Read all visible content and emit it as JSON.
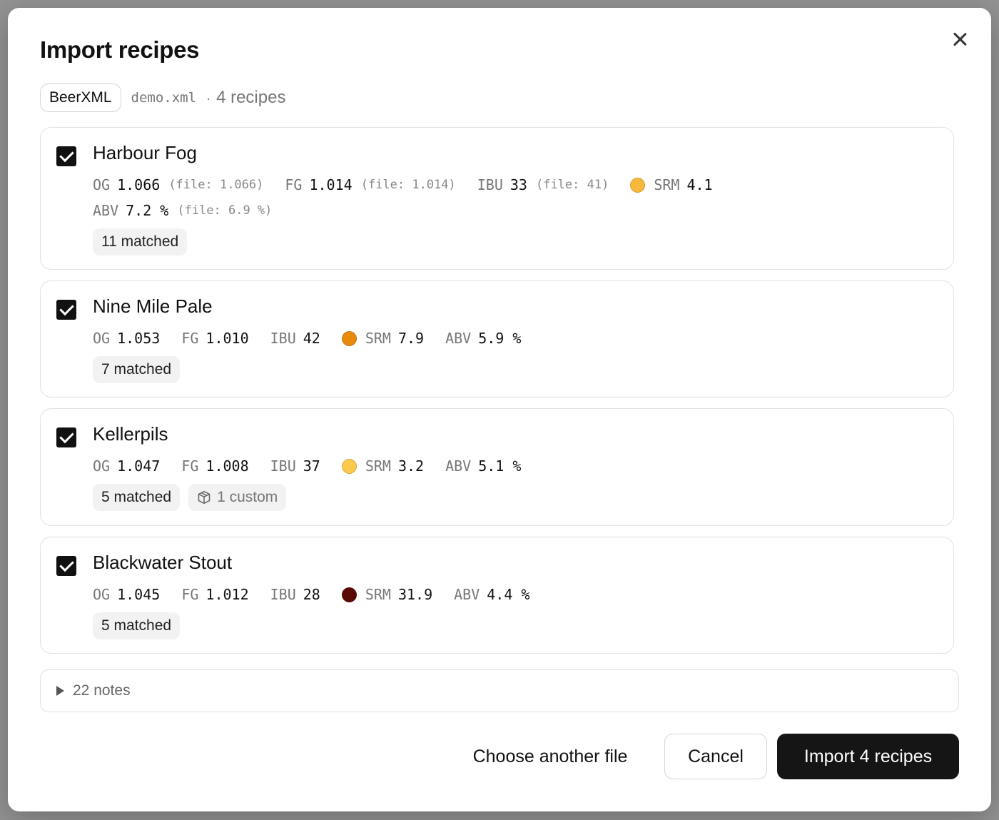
{
  "modal": {
    "title": "Import recipes",
    "format": "BeerXML",
    "file_name": "demo.xml",
    "recipe_count": "4 recipes",
    "separator": "·"
  },
  "recipes": [
    {
      "name": "Harbour Fog",
      "checked": true,
      "stats": {
        "og": {
          "label": "OG",
          "value": "1.066",
          "file": "(file: 1.066)"
        },
        "fg": {
          "label": "FG",
          "value": "1.014",
          "file": "(file: 1.014)"
        },
        "ibu": {
          "label": "IBU",
          "value": "33",
          "file": "(file: 41)"
        },
        "srm": {
          "label": "SRM",
          "value": "4.1",
          "color": "#f6b93b"
        },
        "abv": {
          "label": "ABV",
          "value": "7.2 %",
          "file": "(file: 6.9 %)"
        }
      },
      "badges": [
        "11 matched"
      ]
    },
    {
      "name": "Nine Mile Pale",
      "checked": true,
      "stats": {
        "og": {
          "label": "OG",
          "value": "1.053"
        },
        "fg": {
          "label": "FG",
          "value": "1.010"
        },
        "ibu": {
          "label": "IBU",
          "value": "42"
        },
        "srm": {
          "label": "SRM",
          "value": "7.9",
          "color": "#e88a0c"
        },
        "abv": {
          "label": "ABV",
          "value": "5.9 %"
        }
      },
      "badges": [
        "7 matched"
      ]
    },
    {
      "name": "Kellerpils",
      "checked": true,
      "stats": {
        "og": {
          "label": "OG",
          "value": "1.047"
        },
        "fg": {
          "label": "FG",
          "value": "1.008"
        },
        "ibu": {
          "label": "IBU",
          "value": "37"
        },
        "srm": {
          "label": "SRM",
          "value": "3.2",
          "color": "#fbc94e"
        },
        "abv": {
          "label": "ABV",
          "value": "5.1 %"
        }
      },
      "badges": [
        "5 matched"
      ],
      "custom_badge": "1 custom"
    },
    {
      "name": "Blackwater Stout",
      "checked": true,
      "stats": {
        "og": {
          "label": "OG",
          "value": "1.045"
        },
        "fg": {
          "label": "FG",
          "value": "1.012"
        },
        "ibu": {
          "label": "IBU",
          "value": "28"
        },
        "srm": {
          "label": "SRM",
          "value": "31.9",
          "color": "#5a0a05"
        },
        "abv": {
          "label": "ABV",
          "value": "4.4 %"
        }
      },
      "badges": [
        "5 matched"
      ]
    }
  ],
  "notes": {
    "label": "22 notes"
  },
  "footer": {
    "choose_label": "Choose another file",
    "cancel_label": "Cancel",
    "import_label": "Import 4 recipes"
  },
  "icons": {
    "close": "close-icon",
    "check": "check-icon",
    "package": "package-icon",
    "disclosure": "triangle-right-icon"
  }
}
